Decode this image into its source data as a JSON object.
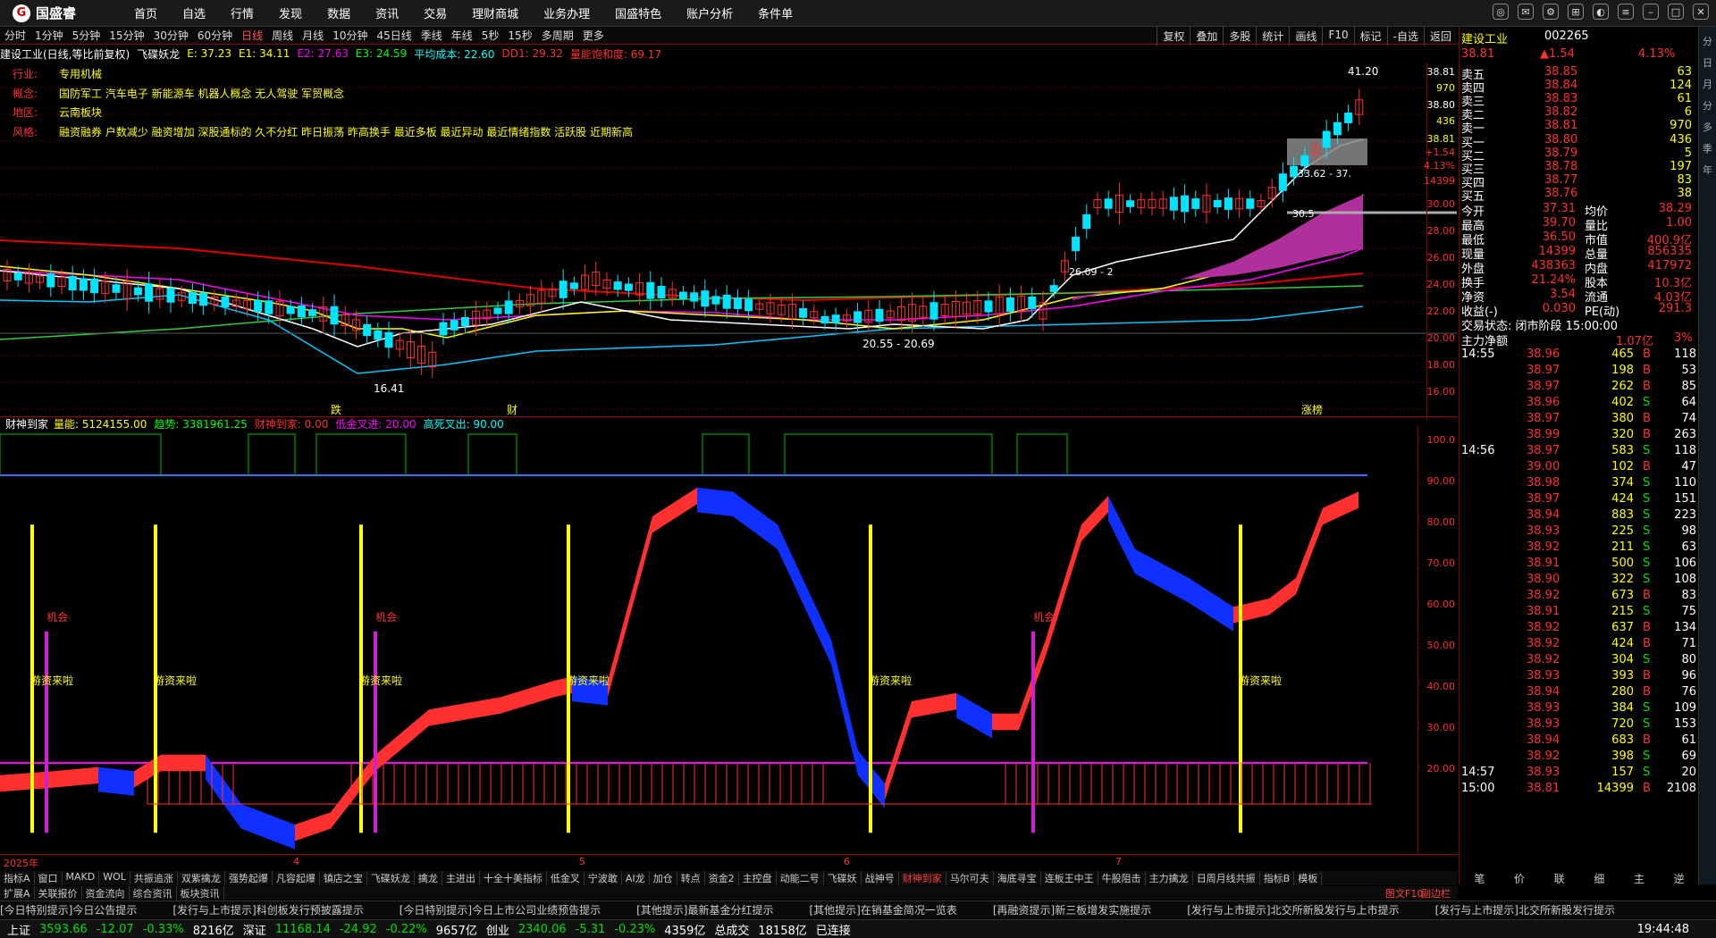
{
  "app": {
    "name": "国盛睿",
    "menu": [
      "首页",
      "自选",
      "行情",
      "发现",
      "数据",
      "资讯",
      "交易",
      "理财商城",
      "业务办理",
      "国盛特色",
      "账户分析",
      "条件单"
    ]
  },
  "periods": [
    "分时",
    "1分钟",
    "5分钟",
    "15分钟",
    "30分钟",
    "60分钟",
    "日线",
    "周线",
    "月线",
    "10分钟",
    "45日线",
    "季线",
    "年线",
    "5秒",
    "15秒",
    "多周期",
    "更多"
  ],
  "active_period": "日线",
  "tool_buttons": [
    "复权",
    "叠加",
    "多股",
    "统计",
    "画线",
    "F10",
    "标记",
    "-自选",
    "返回"
  ],
  "chart_header": {
    "stock": "建设工业(日线,等比前复权)",
    "indicator": "飞碟妖龙",
    "e": "E: 37.23",
    "e1": "E1: 34.11",
    "e2": "E2: 27.63",
    "e3": "E3: 24.59",
    "avg_cost": "平均成本: 22.60",
    "dd1": "DD1: 29.32",
    "sat": "量能饱和度: 69.17"
  },
  "info_lines": [
    {
      "k": "行业:",
      "v": "专用机械"
    },
    {
      "k": "概念:",
      "v": "国防军工 汽车电子 新能源车 机器人概念 无人驾驶 军贸概念"
    },
    {
      "k": "地区:",
      "v": "云南板块"
    },
    {
      "k": "风格:",
      "v": "融资融券 户数减少 融资增加 深股通标的 久不分红 昨日振荡 昨高换手 最近多板 最近异动 最近情绪指数 活跃股 近期新高"
    }
  ],
  "price_axis": [
    "38.81",
    "970",
    "38.80",
    "436",
    "38.81",
    "+1.54",
    "4.13%",
    "14399",
    "30.00",
    "28.00",
    "26.00",
    "24.00",
    "22.00",
    "20.00",
    "18.00",
    "16.00"
  ],
  "price_annotations": {
    "high": "41.20",
    "low": "16.41",
    "range": "20.55 - 20.69",
    "r1": "33.62 - 37.",
    "r2": "26.09 - 2",
    "r3": "30.5"
  },
  "event_labels": {
    "die": "跌",
    "cai": "财",
    "zhangting": "涨榜"
  },
  "sub_header": {
    "name": "财神到家",
    "lm": "量能: 5124155.00",
    "qs": "趋势: 3381961.25",
    "csdj": "财神到家: 0.00",
    "djcj": "低金叉进: 20.00",
    "gscc": "高死叉出: 90.00"
  },
  "sub_axis": [
    "100.0",
    "90.00",
    "80.00",
    "70.00",
    "60.00",
    "50.00",
    "40.00",
    "30.00",
    "20.00"
  ],
  "sub_labels": {
    "chance": "机会",
    "capital": "游资来啦"
  },
  "time_axis": [
    "2025年",
    "4",
    "5",
    "6",
    "7"
  ],
  "tabs": [
    "指标A",
    "窗口",
    "MAKD",
    "WOL",
    "共振追涨",
    "双紫擒龙",
    "强势起爆",
    "凡容起爆",
    "镇店之宝",
    "飞碟妖龙",
    "擒龙",
    "主进出",
    "十全十美指标",
    "低金叉",
    "宁波敢",
    "AI龙",
    "加仓",
    "转点",
    "资金2",
    "主控盘",
    "动能二号",
    "飞碟妖",
    "战神号",
    "财神到家",
    "马尔可夫",
    "海底寻宝",
    "连板王中王",
    "牛股阻击",
    "主力擒龙",
    "日周月线共振",
    "指标B",
    "模板"
  ],
  "active_tab": "财神到家",
  "sub_tabs": [
    "扩展A",
    "关联报价",
    "资金流向",
    "综合资讯",
    "板块资讯"
  ],
  "bottom_right": {
    "label": "图文F10",
    "label2": "副边栏"
  },
  "right_panel": {
    "name": "建设工业",
    "code": "002265",
    "price": "38.81",
    "change": "▲1.54",
    "pct": "4.13%",
    "sell": [
      [
        "卖五",
        "38.85",
        "63"
      ],
      [
        "卖四",
        "38.84",
        "124"
      ],
      [
        "卖三",
        "38.83",
        "61"
      ],
      [
        "卖二",
        "38.82",
        "6"
      ],
      [
        "卖一",
        "38.81",
        "970"
      ]
    ],
    "buy": [
      [
        "买一",
        "38.80",
        "436"
      ],
      [
        "买二",
        "38.79",
        "5"
      ],
      [
        "买三",
        "38.78",
        "197"
      ],
      [
        "买四",
        "38.77",
        "83"
      ],
      [
        "买五",
        "38.76",
        "38"
      ]
    ],
    "stats": [
      [
        "今开",
        "37.31",
        "均价",
        "38.29"
      ],
      [
        "最高",
        "39.70",
        "量比",
        "1.00"
      ],
      [
        "最低",
        "36.50",
        "市值",
        "400.9亿"
      ],
      [
        "现量",
        "14399",
        "总量",
        "856335"
      ],
      [
        "外盘",
        "438363",
        "内盘",
        "417972"
      ],
      [
        "换手",
        "21.24%",
        "股本",
        "10.3亿"
      ],
      [
        "净资",
        "3.54",
        "流通",
        "4.03亿"
      ],
      [
        "收益(-)",
        "0.030",
        "PE(动)",
        "291.3"
      ]
    ],
    "status": "交易状态: 闭市阶段 15:00:00",
    "main_net": "主力净额",
    "main_net_val": "1.07亿",
    "main_net_pct": "3%",
    "ticks": [
      [
        "14:55",
        "38.96",
        "465",
        "B",
        "118"
      ],
      [
        "",
        "38.97",
        "198",
        "B",
        "53"
      ],
      [
        "",
        "38.97",
        "262",
        "B",
        "85"
      ],
      [
        "",
        "38.96",
        "402",
        "S",
        "64"
      ],
      [
        "",
        "38.97",
        "380",
        "B",
        "74"
      ],
      [
        "",
        "38.99",
        "320",
        "B",
        "263"
      ],
      [
        "14:56",
        "38.97",
        "583",
        "S",
        "118"
      ],
      [
        "",
        "39.00",
        "102",
        "B",
        "47"
      ],
      [
        "",
        "38.98",
        "374",
        "S",
        "110"
      ],
      [
        "",
        "38.97",
        "424",
        "S",
        "151"
      ],
      [
        "",
        "38.94",
        "883",
        "S",
        "223"
      ],
      [
        "",
        "38.93",
        "225",
        "S",
        "98"
      ],
      [
        "",
        "38.92",
        "211",
        "S",
        "63"
      ],
      [
        "",
        "38.91",
        "500",
        "S",
        "106"
      ],
      [
        "",
        "38.90",
        "322",
        "S",
        "108"
      ],
      [
        "",
        "38.92",
        "673",
        "B",
        "83"
      ],
      [
        "",
        "38.91",
        "215",
        "S",
        "75"
      ],
      [
        "",
        "38.92",
        "637",
        "B",
        "134"
      ],
      [
        "",
        "38.92",
        "424",
        "B",
        "71"
      ],
      [
        "",
        "38.92",
        "304",
        "S",
        "80"
      ],
      [
        "",
        "38.93",
        "393",
        "B",
        "96"
      ],
      [
        "",
        "38.94",
        "280",
        "B",
        "76"
      ],
      [
        "",
        "38.93",
        "384",
        "S",
        "109"
      ],
      [
        "",
        "38.93",
        "720",
        "S",
        "153"
      ],
      [
        "",
        "38.94",
        "683",
        "B",
        "61"
      ],
      [
        "",
        "38.92",
        "398",
        "S",
        "69"
      ],
      [
        "14:57",
        "38.93",
        "157",
        "S",
        "20"
      ],
      [
        "15:00",
        "38.81",
        "14399",
        "B",
        "2108"
      ]
    ],
    "bottom_tabs": [
      "笔",
      "价",
      "联",
      "细",
      "主",
      "逆"
    ]
  },
  "right_strip": [
    "分",
    "日",
    "月",
    "分",
    "多",
    "季",
    "年"
  ],
  "news": [
    "[今日特别提示]今日公告提示",
    "[发行与上市提示]科创板发行预披露提示",
    "[今日特别提示]今日上市公司业绩预告提示",
    "[其他提示]最新基金分红提示",
    "[其他提示]在销基金简况一览表",
    "[再融资提示]新三板增发实施提示",
    "[发行与上市提示]北交所新股发行与上市提示",
    "[发行与上市提示]北交所新股发行提示"
  ],
  "status": {
    "sh": "上证",
    "sh_v": "3593.66",
    "sh_c": "-12.07",
    "sh_p": "-0.33%",
    "sh_a": "8216亿",
    "sz": "深证",
    "sz_v": "11168.14",
    "sz_c": "-24.92",
    "sz_p": "-0.22%",
    "sz_a": "9657亿",
    "cy": "创业",
    "cy_v": "2340.06",
    "cy_c": "-5.31",
    "cy_p": "-0.23%",
    "cy_a": "4359亿",
    "total": "总成交",
    "total_v": "18158亿",
    "conn": "已连接",
    "time": "19:44:48"
  }
}
